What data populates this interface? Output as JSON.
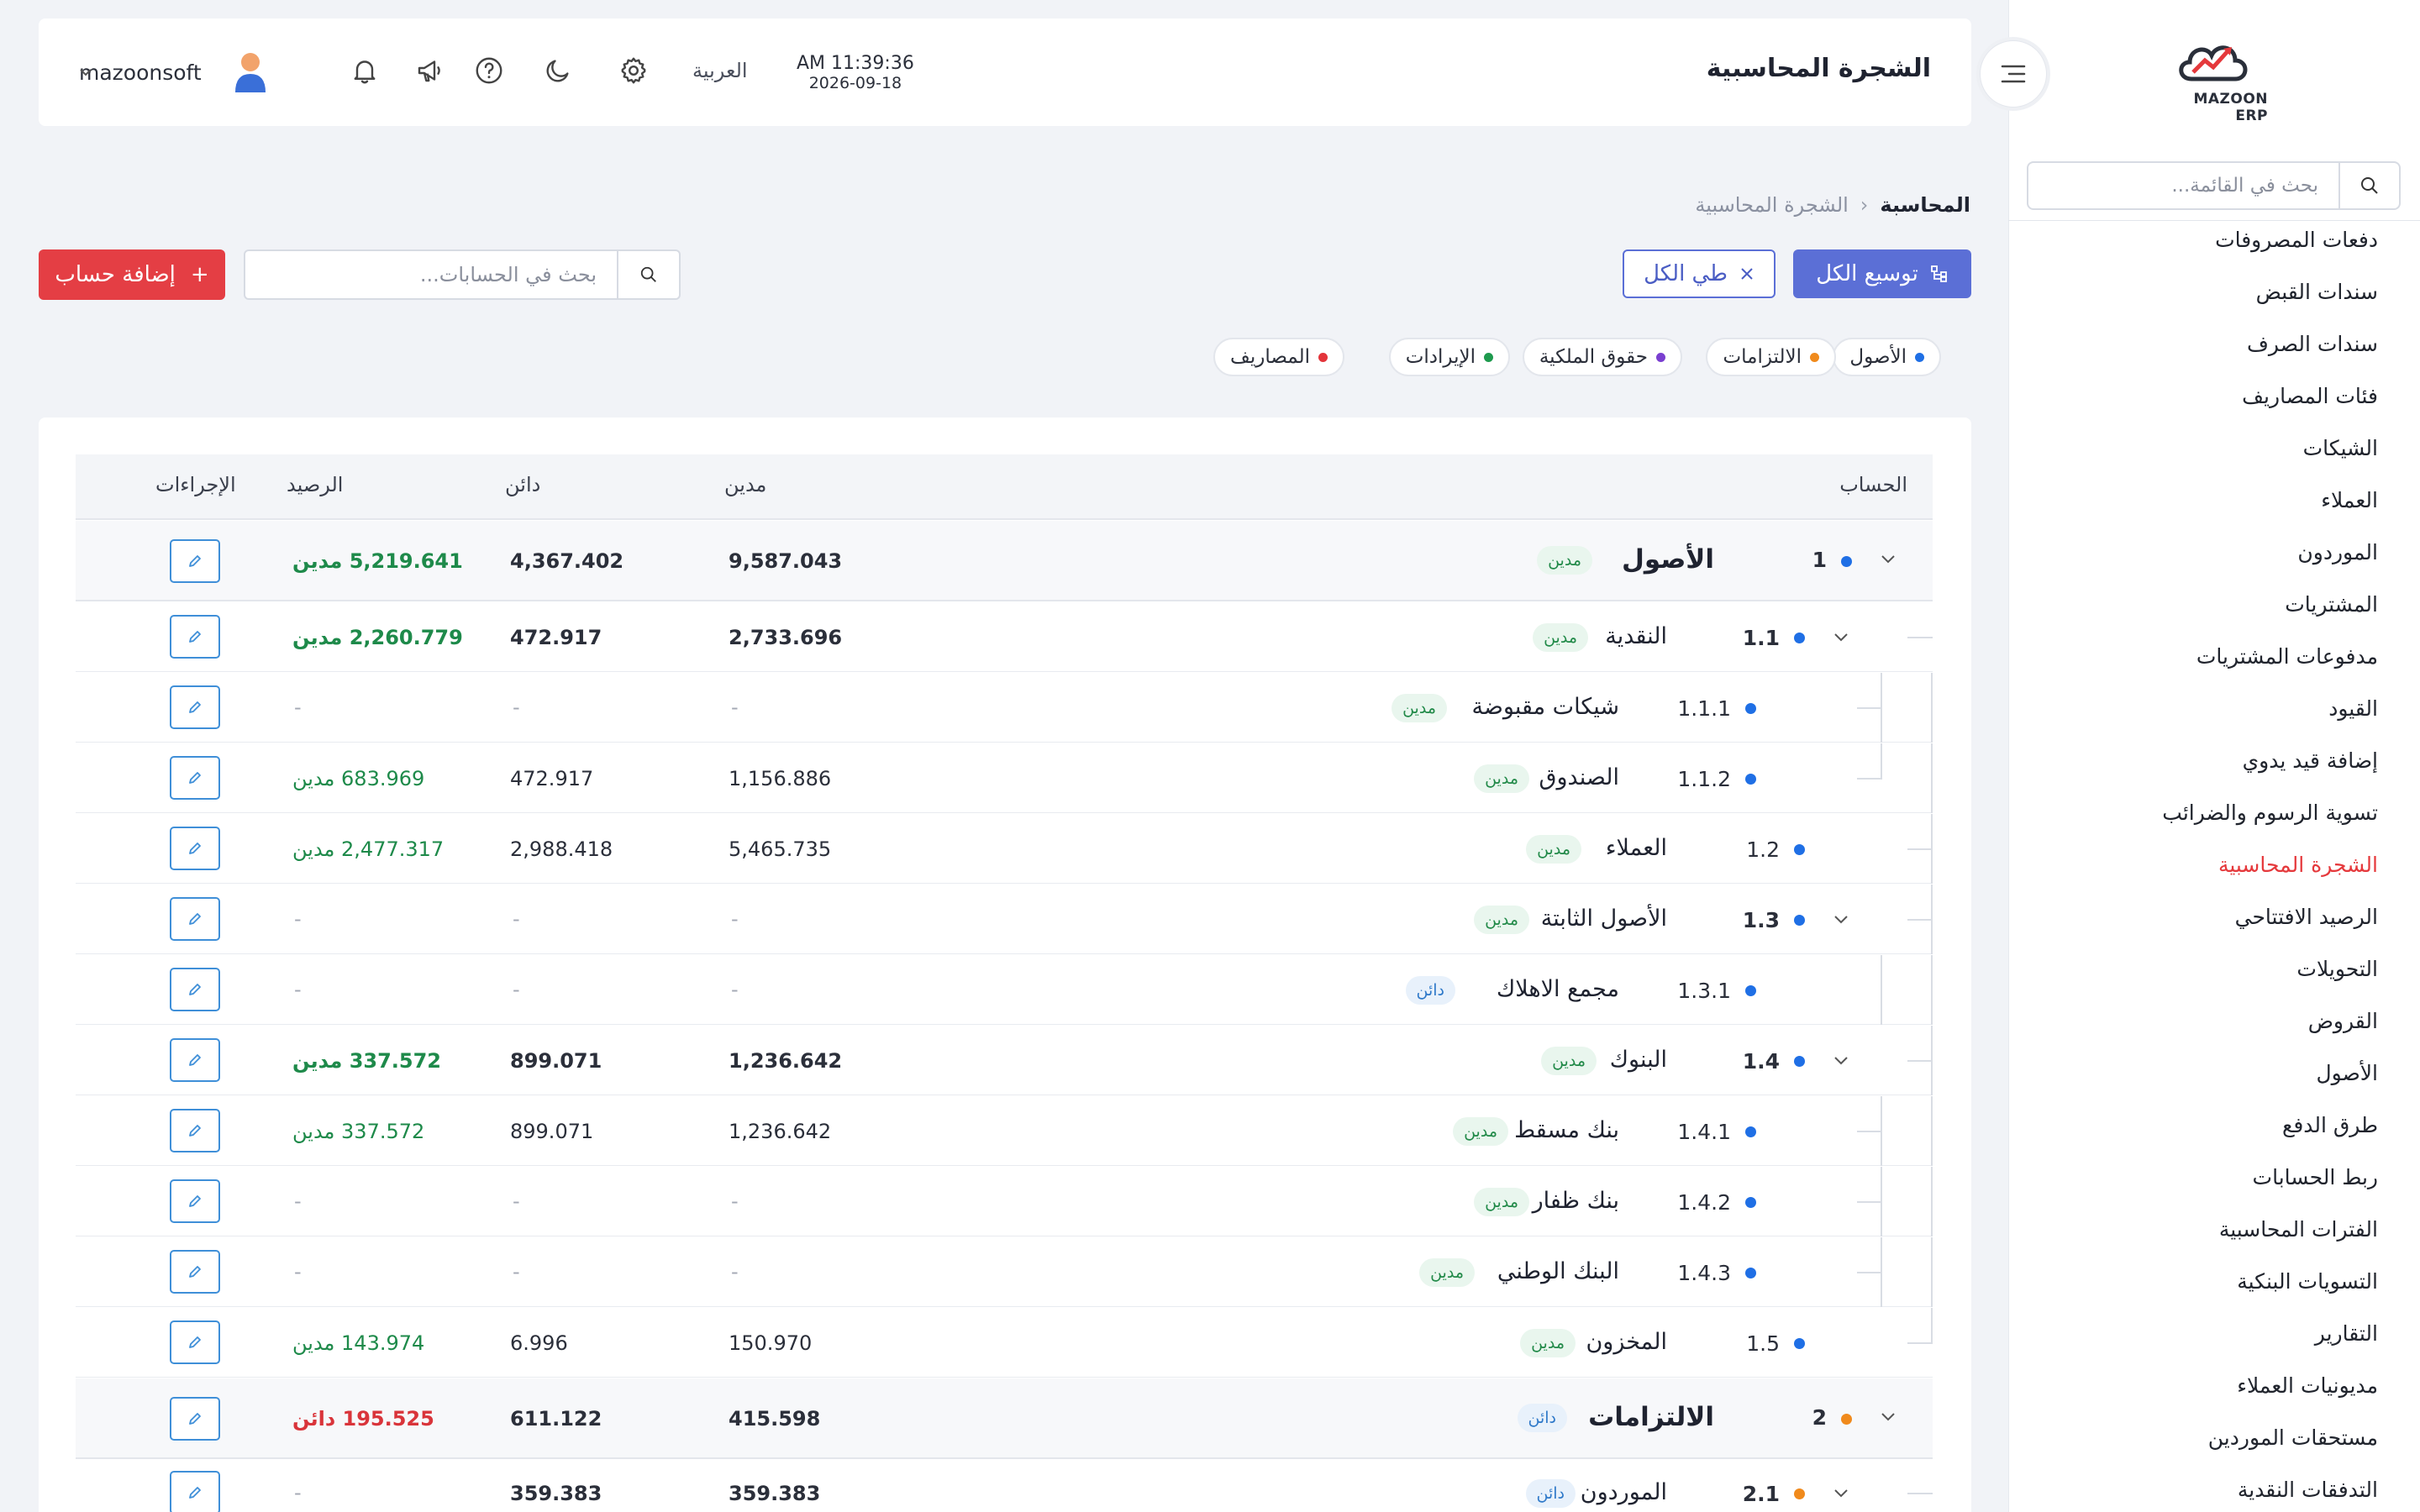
{
  "app": {
    "logo_text": "MAZOON ERP",
    "logo_small": "ERPERP"
  },
  "sidebar": {
    "search_placeholder": "بحث في القائمة...",
    "items": [
      {
        "label": "دفعات المصروفات"
      },
      {
        "label": "سندات القبض"
      },
      {
        "label": "سندات الصرف"
      },
      {
        "label": "فئات المصاريف"
      },
      {
        "label": "الشيكات"
      },
      {
        "label": "العملاء"
      },
      {
        "label": "الموردون"
      },
      {
        "label": "المشتريات"
      },
      {
        "label": "مدفوعات المشتريات"
      },
      {
        "label": "القيود"
      },
      {
        "label": "إضافة قيد يدوي"
      },
      {
        "label": "تسوية الرسوم والضرائب"
      },
      {
        "label": "الشجرة المحاسبية",
        "active": true
      },
      {
        "label": "الرصيد الافتتاحي"
      },
      {
        "label": "التحويلات"
      },
      {
        "label": "القروض"
      },
      {
        "label": "الأصول"
      },
      {
        "label": "طرق الدفع"
      },
      {
        "label": "ربط الحسابات"
      },
      {
        "label": "الفترات المحاسبية"
      },
      {
        "label": "التسويات البنكية"
      },
      {
        "label": "التقارير"
      },
      {
        "label": "مديونيات العملاء"
      },
      {
        "label": "مستحقات الموردين"
      },
      {
        "label": "التدفقات النقدية"
      }
    ]
  },
  "header": {
    "title": "الشجرة المحاسبية",
    "time": "AM 11:39:36",
    "date": "2026-09-18",
    "language": "العربية",
    "username": "mazoonsoft"
  },
  "breadcrumb": {
    "root": "المحاسبة",
    "current": "الشجرة المحاسبية"
  },
  "toolbar": {
    "expand_all": "توسيع الكل",
    "collapse_all": "طي الكل",
    "search_placeholder": "بحث في الحسابات...",
    "add_account": "إضافة حساب"
  },
  "legend": [
    {
      "label": "الأصول",
      "color": "#1f6fe5"
    },
    {
      "label": "الالتزامات",
      "color": "#f08a1c"
    },
    {
      "label": "حقوق الملكية",
      "color": "#7a3fd0"
    },
    {
      "label": "الإيرادات",
      "color": "#1e9a4e"
    },
    {
      "label": "المصاريف",
      "color": "#e3343a"
    }
  ],
  "table": {
    "headers": {
      "account": "الحساب",
      "debit": "مدين",
      "credit": "دائن",
      "balance": "الرصيد",
      "actions": "الإجراءات"
    },
    "rows": [
      {
        "code": "1",
        "name": "الأصول",
        "type": "مدين",
        "debit": "9,587.043",
        "credit": "4,367.402",
        "balance": "5,219.641 مدين"
      },
      {
        "code": "1.1",
        "name": "النقدية",
        "type": "مدين",
        "debit": "2,733.696",
        "credit": "472.917",
        "balance": "2,260.779 مدين"
      },
      {
        "code": "1.1.1",
        "name": "شيكات مقبوضة",
        "type": "مدين",
        "debit": "-",
        "credit": "-",
        "balance": "-"
      },
      {
        "code": "1.1.2",
        "name": "الصندوق",
        "type": "مدين",
        "debit": "1,156.886",
        "credit": "472.917",
        "balance": "683.969 مدين"
      },
      {
        "code": "1.2",
        "name": "العملاء",
        "type": "مدين",
        "debit": "5,465.735",
        "credit": "2,988.418",
        "balance": "2,477.317 مدين"
      },
      {
        "code": "1.3",
        "name": "الأصول الثابتة",
        "type": "مدين",
        "debit": "-",
        "credit": "-",
        "balance": "-"
      },
      {
        "code": "1.3.1",
        "name": "مجمع الاهلاك",
        "type": "دائن",
        "debit": "-",
        "credit": "-",
        "balance": "-"
      },
      {
        "code": "1.4",
        "name": "البنوك",
        "type": "مدين",
        "debit": "1,236.642",
        "credit": "899.071",
        "balance": "337.572 مدين"
      },
      {
        "code": "1.4.1",
        "name": "بنك مسقط",
        "type": "مدين",
        "debit": "1,236.642",
        "credit": "899.071",
        "balance": "337.572 مدين"
      },
      {
        "code": "1.4.2",
        "name": "بنك ظفار",
        "type": "مدين",
        "debit": "-",
        "credit": "-",
        "balance": "-"
      },
      {
        "code": "1.4.3",
        "name": "البنك الوطني",
        "type": "مدين",
        "debit": "-",
        "credit": "-",
        "balance": "-"
      },
      {
        "code": "1.5",
        "name": "المخزون",
        "type": "مدين",
        "debit": "150.970",
        "credit": "6.996",
        "balance": "143.974 مدين"
      },
      {
        "code": "2",
        "name": "الالتزامات",
        "type": "دائن",
        "debit": "415.598",
        "credit": "611.122",
        "balance": "195.525 دائن"
      },
      {
        "code": "2.1",
        "name": "الموردون",
        "type": "دائن",
        "debit": "359.383",
        "credit": "359.383",
        "balance": "-"
      }
    ]
  },
  "colors": {
    "accent": "#5b6fd6",
    "danger": "#e43e44",
    "active_nav": "#e5393c",
    "debit": "#1e8a4a",
    "credit": "#d9343a"
  }
}
